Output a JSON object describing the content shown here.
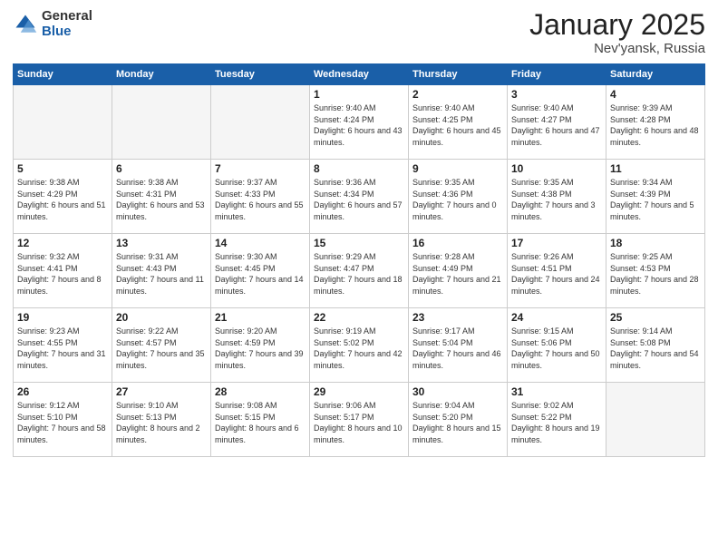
{
  "logo": {
    "general": "General",
    "blue": "Blue"
  },
  "header": {
    "title": "January 2025",
    "subtitle": "Nev'yansk, Russia"
  },
  "weekdays": [
    "Sunday",
    "Monday",
    "Tuesday",
    "Wednesday",
    "Thursday",
    "Friday",
    "Saturday"
  ],
  "weeks": [
    [
      {
        "day": "",
        "info": ""
      },
      {
        "day": "",
        "info": ""
      },
      {
        "day": "",
        "info": ""
      },
      {
        "day": "1",
        "info": "Sunrise: 9:40 AM\nSunset: 4:24 PM\nDaylight: 6 hours and 43 minutes."
      },
      {
        "day": "2",
        "info": "Sunrise: 9:40 AM\nSunset: 4:25 PM\nDaylight: 6 hours and 45 minutes."
      },
      {
        "day": "3",
        "info": "Sunrise: 9:40 AM\nSunset: 4:27 PM\nDaylight: 6 hours and 47 minutes."
      },
      {
        "day": "4",
        "info": "Sunrise: 9:39 AM\nSunset: 4:28 PM\nDaylight: 6 hours and 48 minutes."
      }
    ],
    [
      {
        "day": "5",
        "info": "Sunrise: 9:38 AM\nSunset: 4:29 PM\nDaylight: 6 hours and 51 minutes."
      },
      {
        "day": "6",
        "info": "Sunrise: 9:38 AM\nSunset: 4:31 PM\nDaylight: 6 hours and 53 minutes."
      },
      {
        "day": "7",
        "info": "Sunrise: 9:37 AM\nSunset: 4:33 PM\nDaylight: 6 hours and 55 minutes."
      },
      {
        "day": "8",
        "info": "Sunrise: 9:36 AM\nSunset: 4:34 PM\nDaylight: 6 hours and 57 minutes."
      },
      {
        "day": "9",
        "info": "Sunrise: 9:35 AM\nSunset: 4:36 PM\nDaylight: 7 hours and 0 minutes."
      },
      {
        "day": "10",
        "info": "Sunrise: 9:35 AM\nSunset: 4:38 PM\nDaylight: 7 hours and 3 minutes."
      },
      {
        "day": "11",
        "info": "Sunrise: 9:34 AM\nSunset: 4:39 PM\nDaylight: 7 hours and 5 minutes."
      }
    ],
    [
      {
        "day": "12",
        "info": "Sunrise: 9:32 AM\nSunset: 4:41 PM\nDaylight: 7 hours and 8 minutes."
      },
      {
        "day": "13",
        "info": "Sunrise: 9:31 AM\nSunset: 4:43 PM\nDaylight: 7 hours and 11 minutes."
      },
      {
        "day": "14",
        "info": "Sunrise: 9:30 AM\nSunset: 4:45 PM\nDaylight: 7 hours and 14 minutes."
      },
      {
        "day": "15",
        "info": "Sunrise: 9:29 AM\nSunset: 4:47 PM\nDaylight: 7 hours and 18 minutes."
      },
      {
        "day": "16",
        "info": "Sunrise: 9:28 AM\nSunset: 4:49 PM\nDaylight: 7 hours and 21 minutes."
      },
      {
        "day": "17",
        "info": "Sunrise: 9:26 AM\nSunset: 4:51 PM\nDaylight: 7 hours and 24 minutes."
      },
      {
        "day": "18",
        "info": "Sunrise: 9:25 AM\nSunset: 4:53 PM\nDaylight: 7 hours and 28 minutes."
      }
    ],
    [
      {
        "day": "19",
        "info": "Sunrise: 9:23 AM\nSunset: 4:55 PM\nDaylight: 7 hours and 31 minutes."
      },
      {
        "day": "20",
        "info": "Sunrise: 9:22 AM\nSunset: 4:57 PM\nDaylight: 7 hours and 35 minutes."
      },
      {
        "day": "21",
        "info": "Sunrise: 9:20 AM\nSunset: 4:59 PM\nDaylight: 7 hours and 39 minutes."
      },
      {
        "day": "22",
        "info": "Sunrise: 9:19 AM\nSunset: 5:02 PM\nDaylight: 7 hours and 42 minutes."
      },
      {
        "day": "23",
        "info": "Sunrise: 9:17 AM\nSunset: 5:04 PM\nDaylight: 7 hours and 46 minutes."
      },
      {
        "day": "24",
        "info": "Sunrise: 9:15 AM\nSunset: 5:06 PM\nDaylight: 7 hours and 50 minutes."
      },
      {
        "day": "25",
        "info": "Sunrise: 9:14 AM\nSunset: 5:08 PM\nDaylight: 7 hours and 54 minutes."
      }
    ],
    [
      {
        "day": "26",
        "info": "Sunrise: 9:12 AM\nSunset: 5:10 PM\nDaylight: 7 hours and 58 minutes."
      },
      {
        "day": "27",
        "info": "Sunrise: 9:10 AM\nSunset: 5:13 PM\nDaylight: 8 hours and 2 minutes."
      },
      {
        "day": "28",
        "info": "Sunrise: 9:08 AM\nSunset: 5:15 PM\nDaylight: 8 hours and 6 minutes."
      },
      {
        "day": "29",
        "info": "Sunrise: 9:06 AM\nSunset: 5:17 PM\nDaylight: 8 hours and 10 minutes."
      },
      {
        "day": "30",
        "info": "Sunrise: 9:04 AM\nSunset: 5:20 PM\nDaylight: 8 hours and 15 minutes."
      },
      {
        "day": "31",
        "info": "Sunrise: 9:02 AM\nSunset: 5:22 PM\nDaylight: 8 hours and 19 minutes."
      },
      {
        "day": "",
        "info": ""
      }
    ]
  ]
}
